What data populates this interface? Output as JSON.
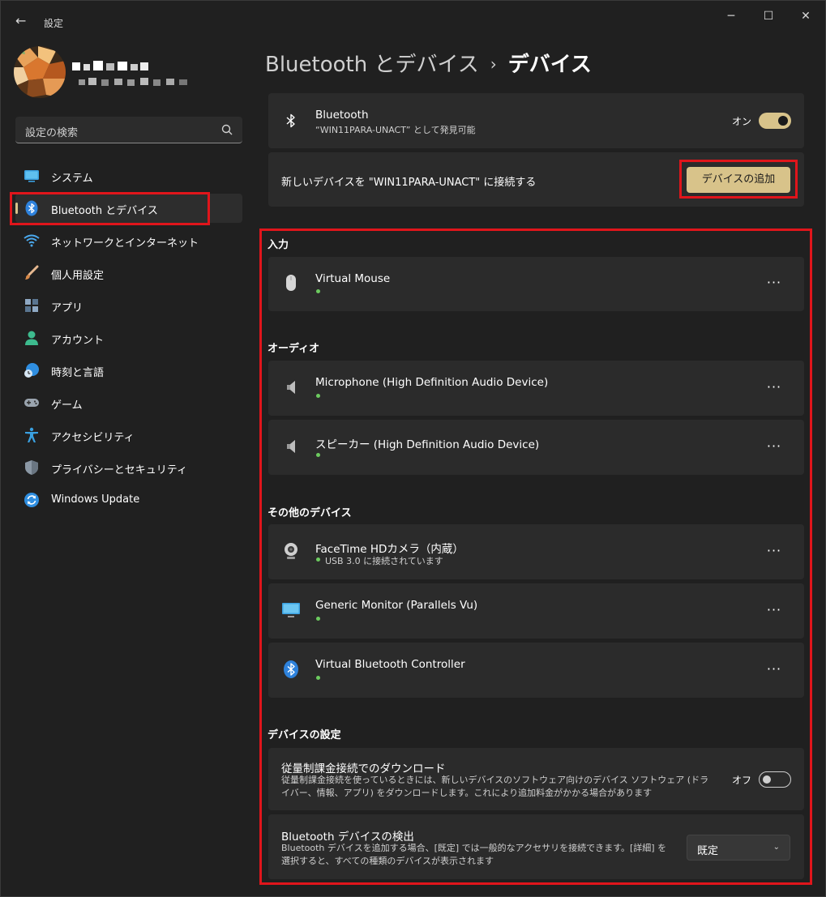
{
  "window": {
    "title": "設定",
    "back_glyph": "←",
    "minimize_glyph": "─",
    "maximize_glyph": "☐",
    "close_glyph": "✕"
  },
  "search": {
    "placeholder": "設定の検索",
    "icon": "search-icon"
  },
  "sidebar": {
    "items": [
      {
        "label": "システム",
        "icon": "system-icon"
      },
      {
        "label": "Bluetooth とデバイス",
        "icon": "bluetooth-icon",
        "active": true
      },
      {
        "label": "ネットワークとインターネット",
        "icon": "wifi-icon"
      },
      {
        "label": "個人用設定",
        "icon": "brush-icon"
      },
      {
        "label": "アプリ",
        "icon": "apps-icon"
      },
      {
        "label": "アカウント",
        "icon": "account-icon"
      },
      {
        "label": "時刻と言語",
        "icon": "time-language-icon"
      },
      {
        "label": "ゲーム",
        "icon": "gamepad-icon"
      },
      {
        "label": "アクセシビリティ",
        "icon": "accessibility-icon"
      },
      {
        "label": "プライバシーとセキュリティ",
        "icon": "shield-icon"
      },
      {
        "label": "Windows Update",
        "icon": "update-icon"
      }
    ]
  },
  "breadcrumb": {
    "parent": "Bluetooth とデバイス",
    "separator": "›",
    "current": "デバイス"
  },
  "bluetooth": {
    "title": "Bluetooth",
    "subtitle": "“WIN11PARA-UNACT” として発見可能",
    "toggle_label": "オン"
  },
  "add_device": {
    "text": "新しいデバイスを \"WIN11PARA-UNACT\" に接続する",
    "button_label": "デバイスの追加"
  },
  "sections": {
    "input": "入力",
    "audio": "オーディオ",
    "other": "その他のデバイス",
    "settings": "デバイスの設定"
  },
  "devices": {
    "mouse": {
      "name": "Virtual Mouse",
      "icon": "mouse-icon"
    },
    "mic": {
      "name": "Microphone (High Definition Audio Device)",
      "icon": "speaker-icon"
    },
    "speaker": {
      "name": "スピーカー (High Definition Audio Device)",
      "icon": "speaker-icon"
    },
    "camera": {
      "name": "FaceTime HDカメラ（内蔵）",
      "status": "USB 3.0 に接続されています",
      "icon": "webcam-icon"
    },
    "monitor": {
      "name": "Generic Monitor (Parallels Vu)",
      "icon": "monitor-icon"
    },
    "bt_controller": {
      "name": "Virtual Bluetooth Controller",
      "icon": "bluetooth-icon"
    }
  },
  "more_glyph": "···",
  "metered": {
    "title": "従量制課金接続でのダウンロード",
    "desc": "従量制課金接続を使っているときには、新しいデバイスのソフトウェア向けのデバイス ソフトウェア (ドライバー、情報、アプリ) をダウンロードします。これにより追加料金がかかる場合があります",
    "toggle_label": "オフ"
  },
  "discovery": {
    "title": "Bluetooth デバイスの検出",
    "desc": "Bluetooth デバイスを追加する場合、[既定] では一般的なアクセサリを接続できます。[詳細] を選択すると、すべての種類のデバイスが表示されます",
    "selected": "既定",
    "chevron": "⌄"
  },
  "colors": {
    "accent": "#d8c38a",
    "highlight": "#e0151b",
    "status_connected": "#6ccb5f",
    "card": "#2b2b2b",
    "background": "#202020"
  }
}
